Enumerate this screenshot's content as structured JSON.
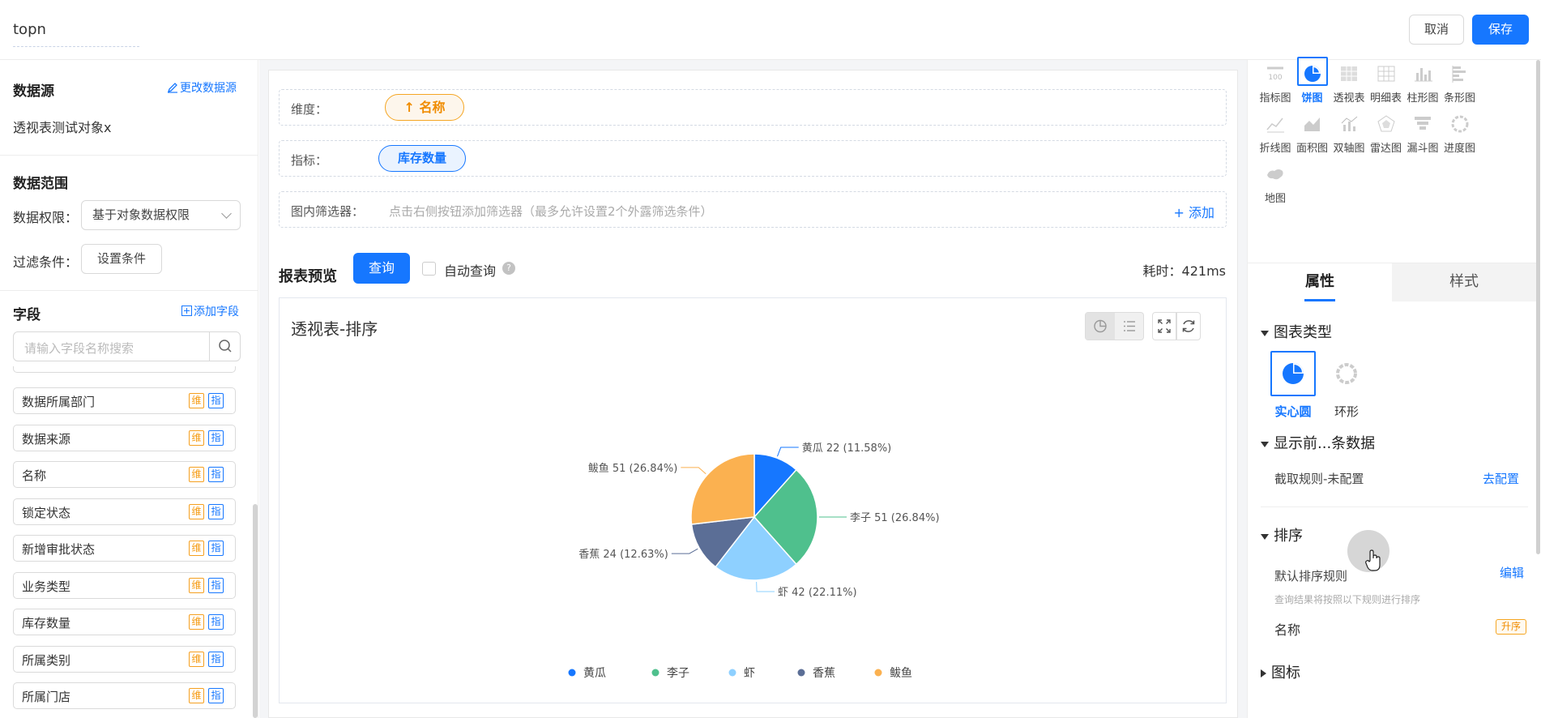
{
  "header": {
    "title": "topn",
    "cancel_label": "取消",
    "save_label": "保存"
  },
  "sidebar": {
    "datasource": {
      "title": "数据源",
      "change_label": "更改数据源",
      "name": "透视表测试对象x"
    },
    "range": {
      "title": "数据范围",
      "permission_label": "数据权限：",
      "permission_value": "基于对象数据权限",
      "filter_label": "过滤条件：",
      "filter_button": "设置条件"
    },
    "fields": {
      "title": "字段",
      "add_label": "添加字段",
      "search_placeholder": "请输入字段名称搜索",
      "dim_tag": "维",
      "metric_tag": "指",
      "items": [
        "数据所属部门",
        "数据来源",
        "名称",
        "锁定状态",
        "新增审批状态",
        "业务类型",
        "库存数量",
        "所属类别",
        "所属门店"
      ]
    }
  },
  "builder": {
    "dimension_label": "维度：",
    "dimension_value": "名称",
    "metric_label": "指标：",
    "metric_value": "库存数量",
    "filter_label": "图内筛选器：",
    "filter_hint": "点击右侧按钮添加筛选器（最多允许设置2个外露筛选条件）",
    "add_label": "添加"
  },
  "preview": {
    "title": "报表预览",
    "query_button": "查询",
    "auto_query_label": "自动查询",
    "elapsed": "耗时：421ms"
  },
  "chart_data": {
    "type": "pie",
    "title": "透视表-排序",
    "legend_position": "bottom",
    "categories": [
      "黄瓜",
      "李子",
      "虾",
      "香蕉",
      "鲅鱼"
    ],
    "values": [
      22,
      51,
      42,
      24,
      51
    ],
    "labels": [
      "黄瓜 22 (11.58%)",
      "李子 51 (26.84%)",
      "虾 42 (22.11%)",
      "香蕉 24 (12.63%)",
      "鲅鱼 51 (26.84%)"
    ],
    "colors": [
      "#1677ff",
      "#4fc08d",
      "#8ed0ff",
      "#5b6e96",
      "#fbb150"
    ]
  },
  "chart_types": [
    {
      "label": "指标图",
      "icon": "number-chart-icon"
    },
    {
      "label": "饼图",
      "icon": "pie-chart-icon",
      "selected": true
    },
    {
      "label": "透视表",
      "icon": "pivot-table-icon"
    },
    {
      "label": "明细表",
      "icon": "detail-table-icon"
    },
    {
      "label": "柱形图",
      "icon": "column-chart-icon"
    },
    {
      "label": "条形图",
      "icon": "bar-chart-icon"
    },
    {
      "label": "折线图",
      "icon": "line-chart-icon"
    },
    {
      "label": "面积图",
      "icon": "area-chart-icon"
    },
    {
      "label": "双轴图",
      "icon": "dual-axis-chart-icon"
    },
    {
      "label": "雷达图",
      "icon": "radar-chart-icon"
    },
    {
      "label": "漏斗图",
      "icon": "funnel-chart-icon"
    },
    {
      "label": "进度图",
      "icon": "progress-chart-icon"
    },
    {
      "label": "地图",
      "icon": "map-chart-icon"
    }
  ],
  "props": {
    "tab_attr": "属性",
    "tab_style": "样式",
    "chart_type_title": "图表类型",
    "pie_solid": "实心圆",
    "pie_ring": "环形",
    "topn_title": "显示前...条数据",
    "topn_rule": "截取规则-未配置",
    "topn_config": "去配置",
    "sort_title": "排序",
    "sort_default": "默认排序规则",
    "sort_edit": "编辑",
    "sort_desc": "查询结果将按照以下规则进行排序",
    "sort_field": "名称",
    "sort_order": "升序",
    "icon_title": "图标"
  }
}
